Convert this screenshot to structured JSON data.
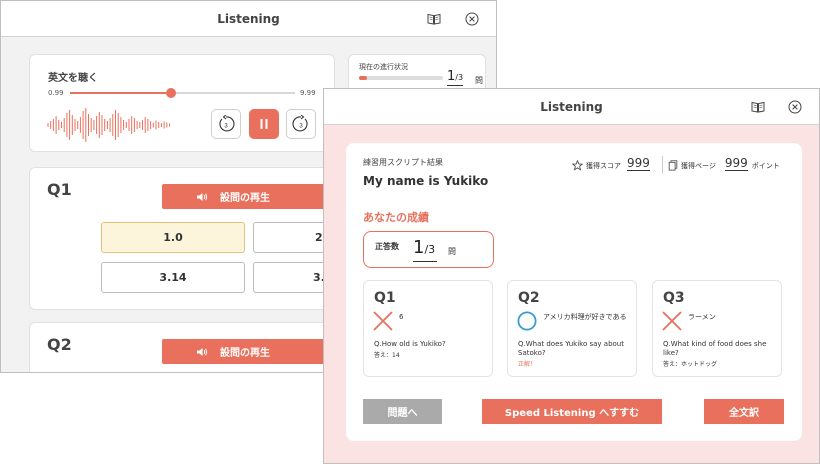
{
  "back_window": {
    "title": "Listening",
    "player": {
      "label": "英文を聴く",
      "time_start": "0.99",
      "time_end": "9.99",
      "position_fraction": 0.45,
      "rewind_label": "3",
      "forward_label": "3"
    },
    "progress": {
      "label": "現在の進行状況",
      "current": "1",
      "total": "/3",
      "unit": "問",
      "fraction": 0.1
    },
    "questions": [
      {
        "label": "Q1",
        "play_label": "設問の再生",
        "choices": [
          "1.0",
          "2",
          "3.14",
          "3."
        ]
      },
      {
        "label": "Q2",
        "play_label": "設問の再生"
      }
    ]
  },
  "front_window": {
    "title": "Listening",
    "subheading": "練習用スクリプト結果",
    "song_title": "My name is Yukiko",
    "score": {
      "label": "獲得スコア",
      "value": "999"
    },
    "pages": {
      "label": "獲得ページ",
      "value": "999",
      "unit": "ポイント"
    },
    "result_heading": "あなたの成績",
    "correct": {
      "label": "正答数",
      "value": "1",
      "total": "/3",
      "unit": "問"
    },
    "results": [
      {
        "label": "Q1",
        "mark": "cross",
        "answer": "6",
        "question": "Q.How old is Yukiko?",
        "note": "答え：14",
        "note_color": "#333333"
      },
      {
        "label": "Q2",
        "mark": "circle",
        "answer": "アメリカ料理が好きである",
        "question": "Q.What does Yukiko say about Satoko?",
        "note": "正解！",
        "note_color": "#e9705c"
      },
      {
        "label": "Q3",
        "mark": "cross",
        "answer": "ラーメン",
        "question": "Q.What kind of food does she like?",
        "note": "答え：ホットドッグ",
        "note_color": "#333333"
      }
    ],
    "buttons": {
      "back": "問題へ",
      "speed": "Speed Listening へすすむ",
      "full_text": "全文訳"
    }
  },
  "colors": {
    "accent": "#e9705c",
    "circle_mark": "#3a9bd1",
    "selected_choice_bg": "#fdf5db",
    "front_bg": "#fbe3e3"
  },
  "icons": {
    "book": "book-icon",
    "close": "close-icon",
    "speaker": "speaker-icon",
    "rewind": "rewind-3-icon",
    "forward": "forward-3-icon",
    "pause": "pause-icon",
    "star": "star-icon",
    "page": "page-icon"
  }
}
